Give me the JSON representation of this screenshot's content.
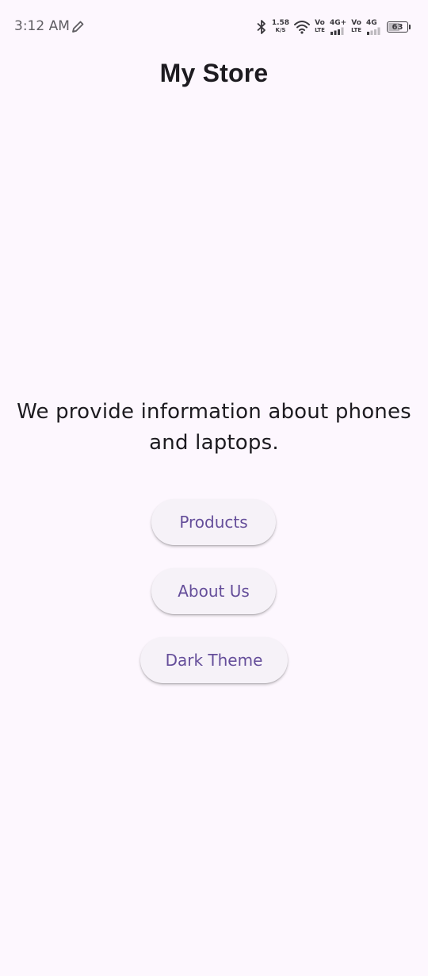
{
  "status_bar": {
    "time": "3:12 AM",
    "data_speed_value": "1.58",
    "data_speed_unit": "K/S",
    "volte1_top": "Vo",
    "volte1_bottom": "LTE",
    "net1": "4G+",
    "volte2_top": "Vo",
    "volte2_bottom": "LTE",
    "net2": "4G",
    "battery_level": "63",
    "battery_fraction": 0.63,
    "icons": [
      "pen-icon",
      "bluetooth-icon",
      "wifi-icon",
      "signal-icon",
      "signal-icon",
      "battery-icon"
    ]
  },
  "app_bar": {
    "title": "My Store"
  },
  "main": {
    "description": "We provide information about phones and laptops.",
    "buttons": [
      {
        "label": "Products"
      },
      {
        "label": "About Us"
      },
      {
        "label": "Dark Theme"
      }
    ]
  },
  "colors": {
    "background": "#fdf7fe",
    "button_bg": "#f6f2f8",
    "button_text": "#654e9a",
    "text": "#1d1b20"
  }
}
